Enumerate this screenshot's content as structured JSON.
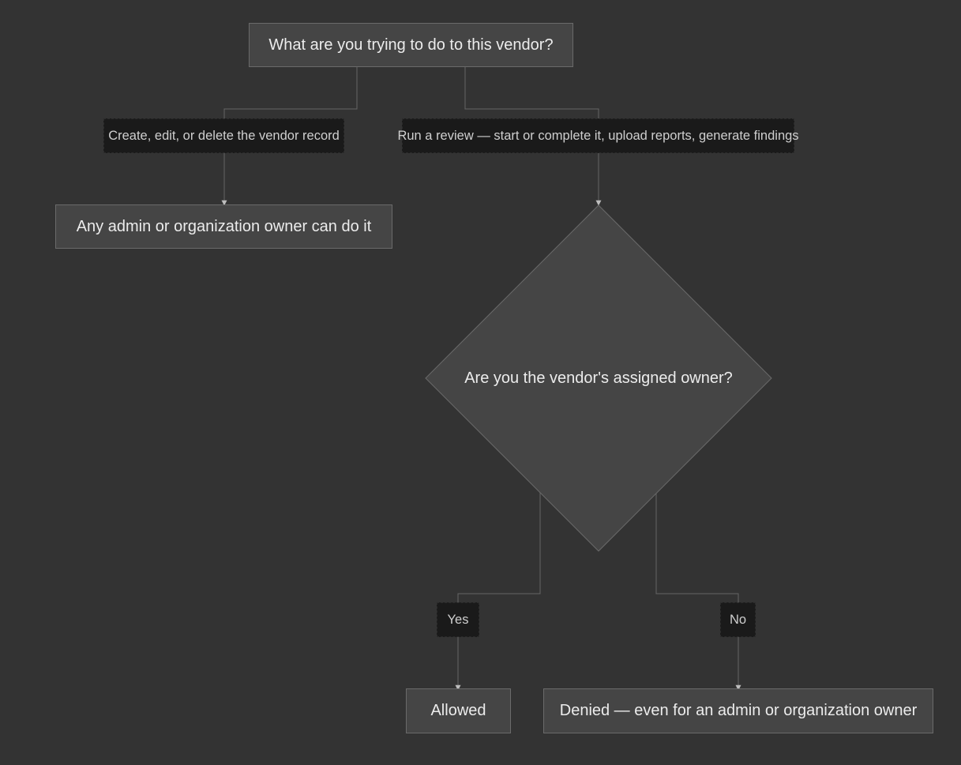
{
  "diagram": {
    "start": "What are you trying to do to this vendor?",
    "edge_manage": "Create, edit, or delete the vendor record",
    "edge_review": "Run a review — start or complete it, upload reports, generate findings",
    "admin_result": "Any admin or organization owner can do it",
    "decision": "Are you the vendor's assigned owner?",
    "edge_yes": "Yes",
    "edge_no": "No",
    "allowed": "Allowed",
    "denied": "Denied — even for an admin or organization owner"
  },
  "colors": {
    "background": "#333333",
    "node_fill": "#454545",
    "node_border": "#6a6a6a",
    "label_fill": "#1a1a1a",
    "connector": "#666666",
    "arrowhead": "#bdbdbd"
  }
}
